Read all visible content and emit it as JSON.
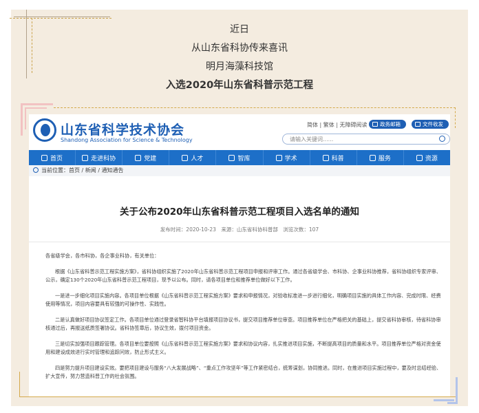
{
  "intro": {
    "line1": "近日",
    "line2": "从山东省科协传来喜讯",
    "line3": "明月海藻科技馆",
    "line4": "入选2020年山东省科普示范工程"
  },
  "site": {
    "logo_cn": "山东省科学技术协会",
    "logo_en": "Shandong Association for Science & Technology",
    "top_links": "简体 | 繁体 | 无障碍阅读",
    "mail_label": "政务邮箱",
    "docs_label": "文件收发",
    "search_placeholder": "请输入关键词......",
    "nav": [
      {
        "label": "首页",
        "icon": "home-icon"
      },
      {
        "label": "走进科协",
        "icon": "globe-icon"
      },
      {
        "label": "党建",
        "icon": "party-icon"
      },
      {
        "label": "人才",
        "icon": "person-icon"
      },
      {
        "label": "智库",
        "icon": "book-icon"
      },
      {
        "label": "学术",
        "icon": "academic-icon"
      },
      {
        "label": "科普",
        "icon": "science-icon"
      },
      {
        "label": "服务",
        "icon": "service-icon"
      },
      {
        "label": "资源",
        "icon": "resource-icon"
      }
    ],
    "breadcrumb": "当前位置：首页 / 新闻 / 通知通告"
  },
  "article": {
    "title": "关于公布2020年山东省科普示范工程项目入选名单的通知",
    "meta": "发布时间：2020-10-23　来源：山东省科协科普部　浏览次数：107",
    "salutation": "各省级学会，各市科协，各企事业科协，有关单位：",
    "paragraphs": [
      "根据《山东省科普示范工程实施方案》，省科协组织实施了2020年山东省科普示范工程项目申报和评审工作。通过各省级学会、市科协、企事业科协推荐，省科协组织专家评审、公示，确定130个2020年山东省科普示范工程项目，现予以公布。同时，请各项目单位和推荐单位做好以下工作。",
      "一是进一步细化项目实施内容。各项目单位根据《山东省科普示范工程实施方案》要求和申报情况，对验收标准进一步进行细化，明确项目实施的具体工作内容、完成时限、经费使用等情况，项目内容要具有较强的可操作性、实践性。",
      "二是认真做好项目协议签定工作。各项目单位通过登录省智科协平台填报项目协议书，提交项目推荐单位审查。项目推荐单位在严格把关的基础上，提交省科协审核，待省科协审核通过后，再报送纸质签署协议。省科协签章后，协议生效，拨付项目资金。",
      "三是切实加强项目跟踪管理。各项目单位要按照《山东省科普示范工程实施方案》要求和协议内容，扎实推进项目实施，不断提高项目的质量和水平。项目推荐单位严格对资金使用和建设成效进行实时管理和追踪问效，防止形式主义。",
      "四是努力提升项目建设实效。要把项目建设与服务“八大发展战略”、“重点工作攻坚年”等工作紧密结合，统筹谋划，协同推进。同时，在推进项目实施过程中，要及时总结经验、扩大宣传，努力营造科普工作的社会氛围。"
    ]
  },
  "colors": {
    "brand_blue": "#1e5fb4",
    "nav_blue": "#1d6fc8",
    "cream": "#f4ece0",
    "gold": "#d4a94a"
  }
}
